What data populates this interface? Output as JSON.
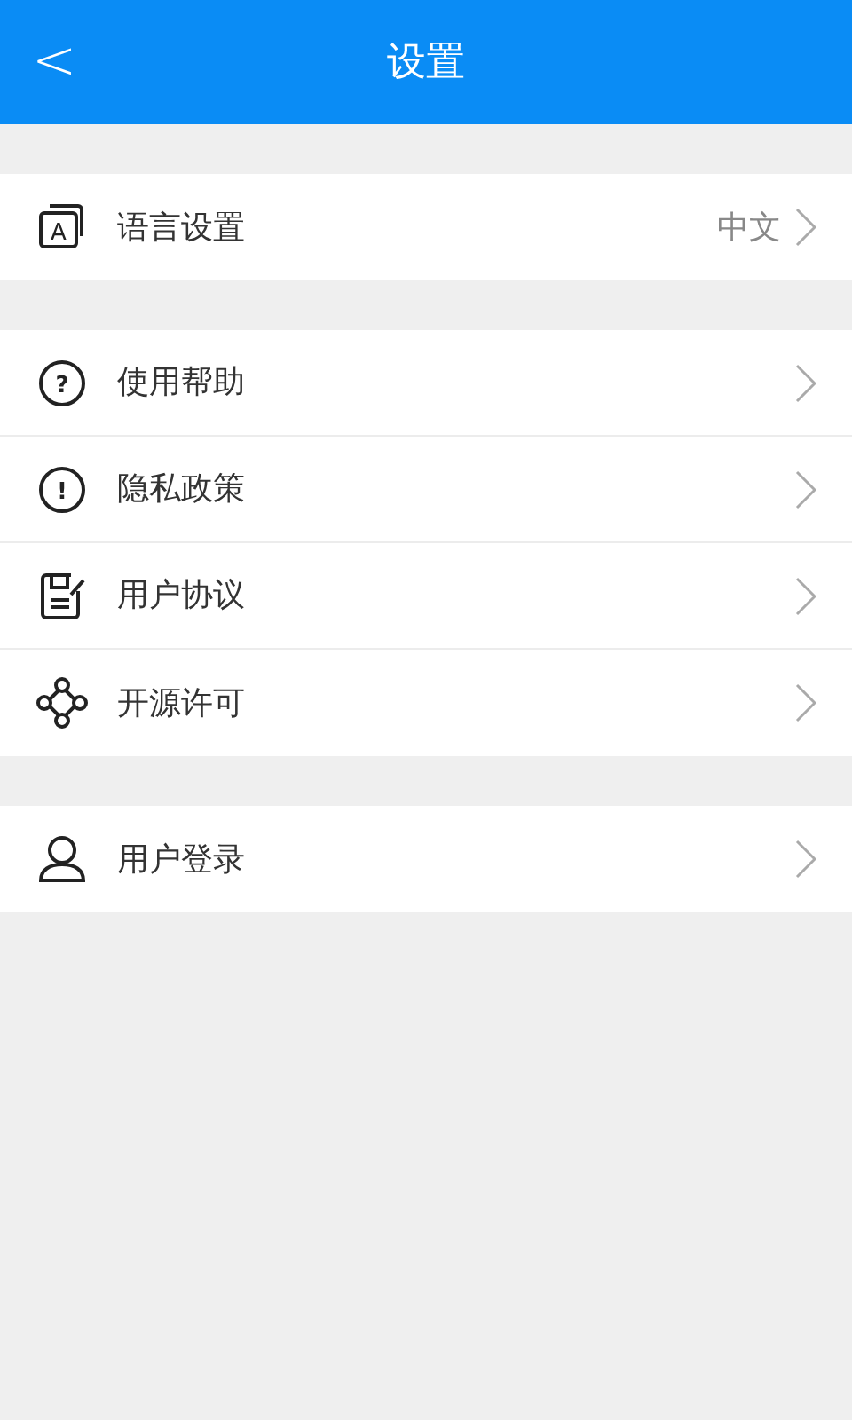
{
  "header": {
    "back": "<",
    "title": "设置"
  },
  "groups": [
    {
      "items": [
        {
          "kind": "language",
          "icon_text": "A",
          "label": "语言设置",
          "value": "中文"
        }
      ]
    },
    {
      "items": [
        {
          "kind": "help",
          "icon_text": "?",
          "label": "使用帮助"
        },
        {
          "kind": "privacy",
          "icon_text": "!",
          "label": "隐私政策"
        },
        {
          "kind": "agreement",
          "label": "用户协议"
        },
        {
          "kind": "license",
          "label": "开源许可"
        }
      ]
    },
    {
      "items": [
        {
          "kind": "login",
          "label": "用户登录"
        }
      ]
    }
  ]
}
